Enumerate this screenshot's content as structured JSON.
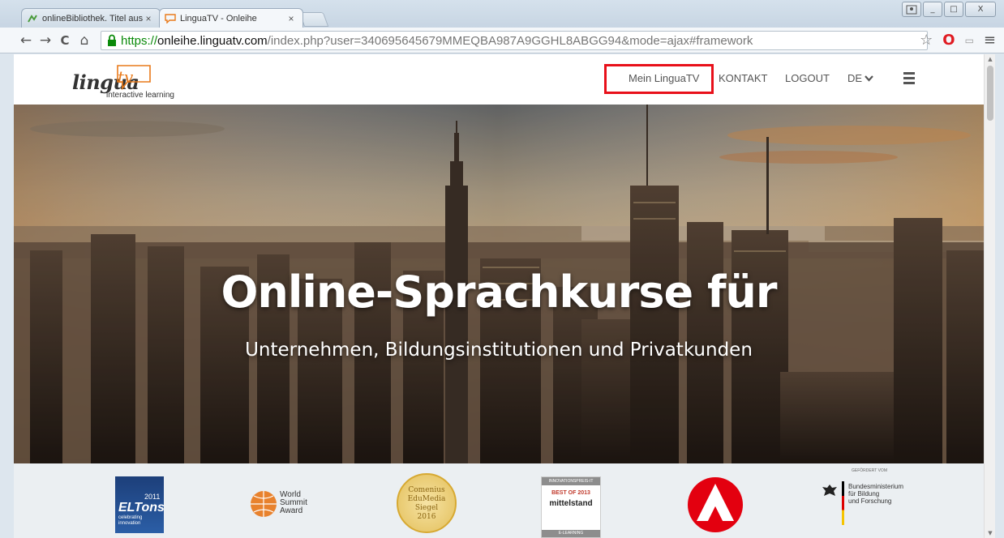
{
  "browser": {
    "tabs": [
      {
        "title": "onlineBibliothek. Titel aus",
        "close": "×",
        "active": false
      },
      {
        "title": "LinguaTV - Onleihe",
        "close": "×",
        "active": true
      }
    ],
    "window_controls": [
      "_",
      "□",
      "X"
    ],
    "url": {
      "scheme": "https://",
      "host": "onleihe.linguatv.com",
      "rest": "/index.php?user=340695645679MMEQBA987A9GGHL8ABGG94&mode=ajax#framework"
    },
    "nav_glyphs": {
      "back": "←",
      "forward": "→",
      "reload": "C",
      "home": "⌂"
    },
    "toolbar_glyphs": {
      "star": "☆",
      "opera": "O",
      "keyboard": "▭",
      "menu": "≡"
    }
  },
  "site": {
    "logo": {
      "word": "lingua",
      "tv": "tv",
      "tagline": "interactive learning"
    },
    "nav": {
      "mein": "Mein LinguaTV",
      "kontakt": "KONTAKT",
      "logout": "LOGOUT",
      "lang": "DE"
    },
    "hero": {
      "title": "Online-Sprachkurse für",
      "subtitle": "Unternehmen, Bildungsinstitutionen und Privatkunden"
    },
    "awards": {
      "eltons_year": "2011",
      "eltons_name": "ELTons",
      "eltons_tag": "celebrating innovation",
      "wsa": [
        "World",
        "Summit",
        "Award"
      ],
      "comenius": [
        "Comenius",
        "EduMedia",
        "Siegel",
        "2016"
      ],
      "innov_header": "INNOVATIONSPREIS-IT",
      "innov_best": "BEST OF 2013",
      "innov_mittelstand": "mittelstand",
      "innov_footer": "E-LEARNING",
      "bmbf_header": "GEFÖRDERT VOM",
      "bmbf_lines": [
        "Bundesministerium",
        "für Bildung",
        "und Forschung"
      ]
    }
  },
  "colors": {
    "accent_orange": "#e97a1a",
    "highlight_red": "#e8101a",
    "url_green": "#0a8a0a"
  }
}
